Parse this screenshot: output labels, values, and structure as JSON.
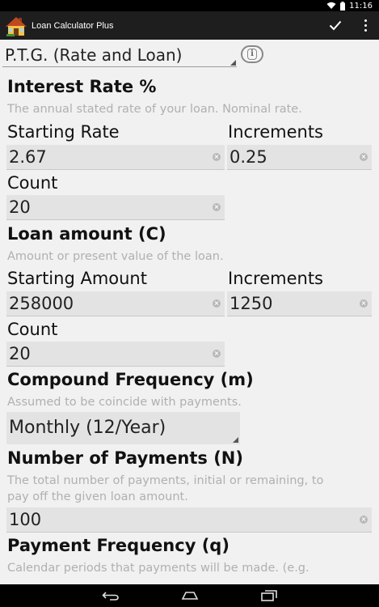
{
  "status_bar": {
    "time": "11:16"
  },
  "action_bar": {
    "title": "Loan Calculator Plus"
  },
  "calc_type": {
    "selected": "P.T.G. (Rate and Loan)"
  },
  "interest": {
    "title": "Interest Rate %",
    "hint": "The annual stated rate of your loan. Nominal rate.",
    "starting_label": "Starting Rate",
    "starting_value": "2.67",
    "increments_label": "Increments",
    "increments_value": "0.25",
    "count_label": "Count",
    "count_value": "20"
  },
  "loan": {
    "title": "Loan amount (C)",
    "hint": "Amount or present value of the loan.",
    "starting_label": "Starting Amount",
    "starting_value": "258000",
    "increments_label": "Increments",
    "increments_value": "1250",
    "count_label": "Count",
    "count_value": "20"
  },
  "compound": {
    "title": "Compound Frequency (m)",
    "hint": "Assumed to be coincide with payments.",
    "selected": "Monthly (12/Year)"
  },
  "payments": {
    "title": "Number of Payments (N)",
    "hint_line1": "The total number of payments, initial or remaining, to",
    "hint_line2": "pay off the given loan amount.",
    "value": "100"
  },
  "payment_freq": {
    "title": "Payment Frequency (q)",
    "hint": "Calendar periods that payments will be made. (e.g."
  },
  "colors": {
    "action_bar": "#1e1e1e",
    "field_bg": "#e3e3e3",
    "hint": "#b0b0b0",
    "background": "#f1f1f1"
  }
}
